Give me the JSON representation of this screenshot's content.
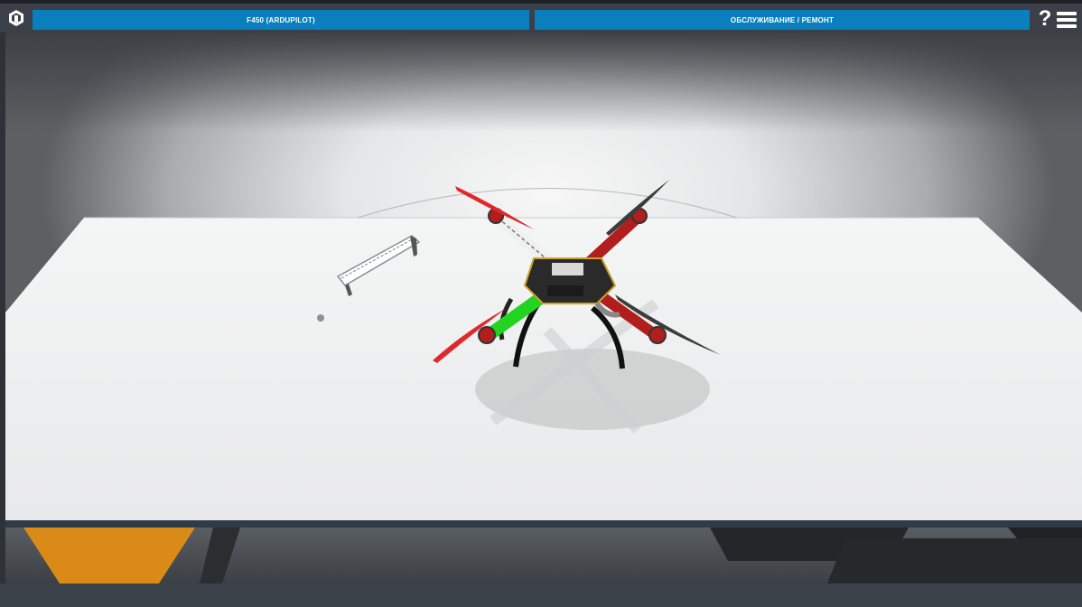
{
  "topbar": {
    "logo_icon": "app-logo-icon",
    "model_title": "F450 (ARDUPILOT)",
    "mode_title": "ОБСЛУЖИВАНИЕ / РЕМОНТ",
    "help_label": "?",
    "menu_icon": "hamburger-menu-icon"
  },
  "scene": {
    "objects": [
      "quadcopter-drone",
      "loose-frame-arm",
      "loose-screw",
      "white-table"
    ],
    "highlighted_part_color": "#22d322",
    "accent_color": "#0a7fbd"
  }
}
